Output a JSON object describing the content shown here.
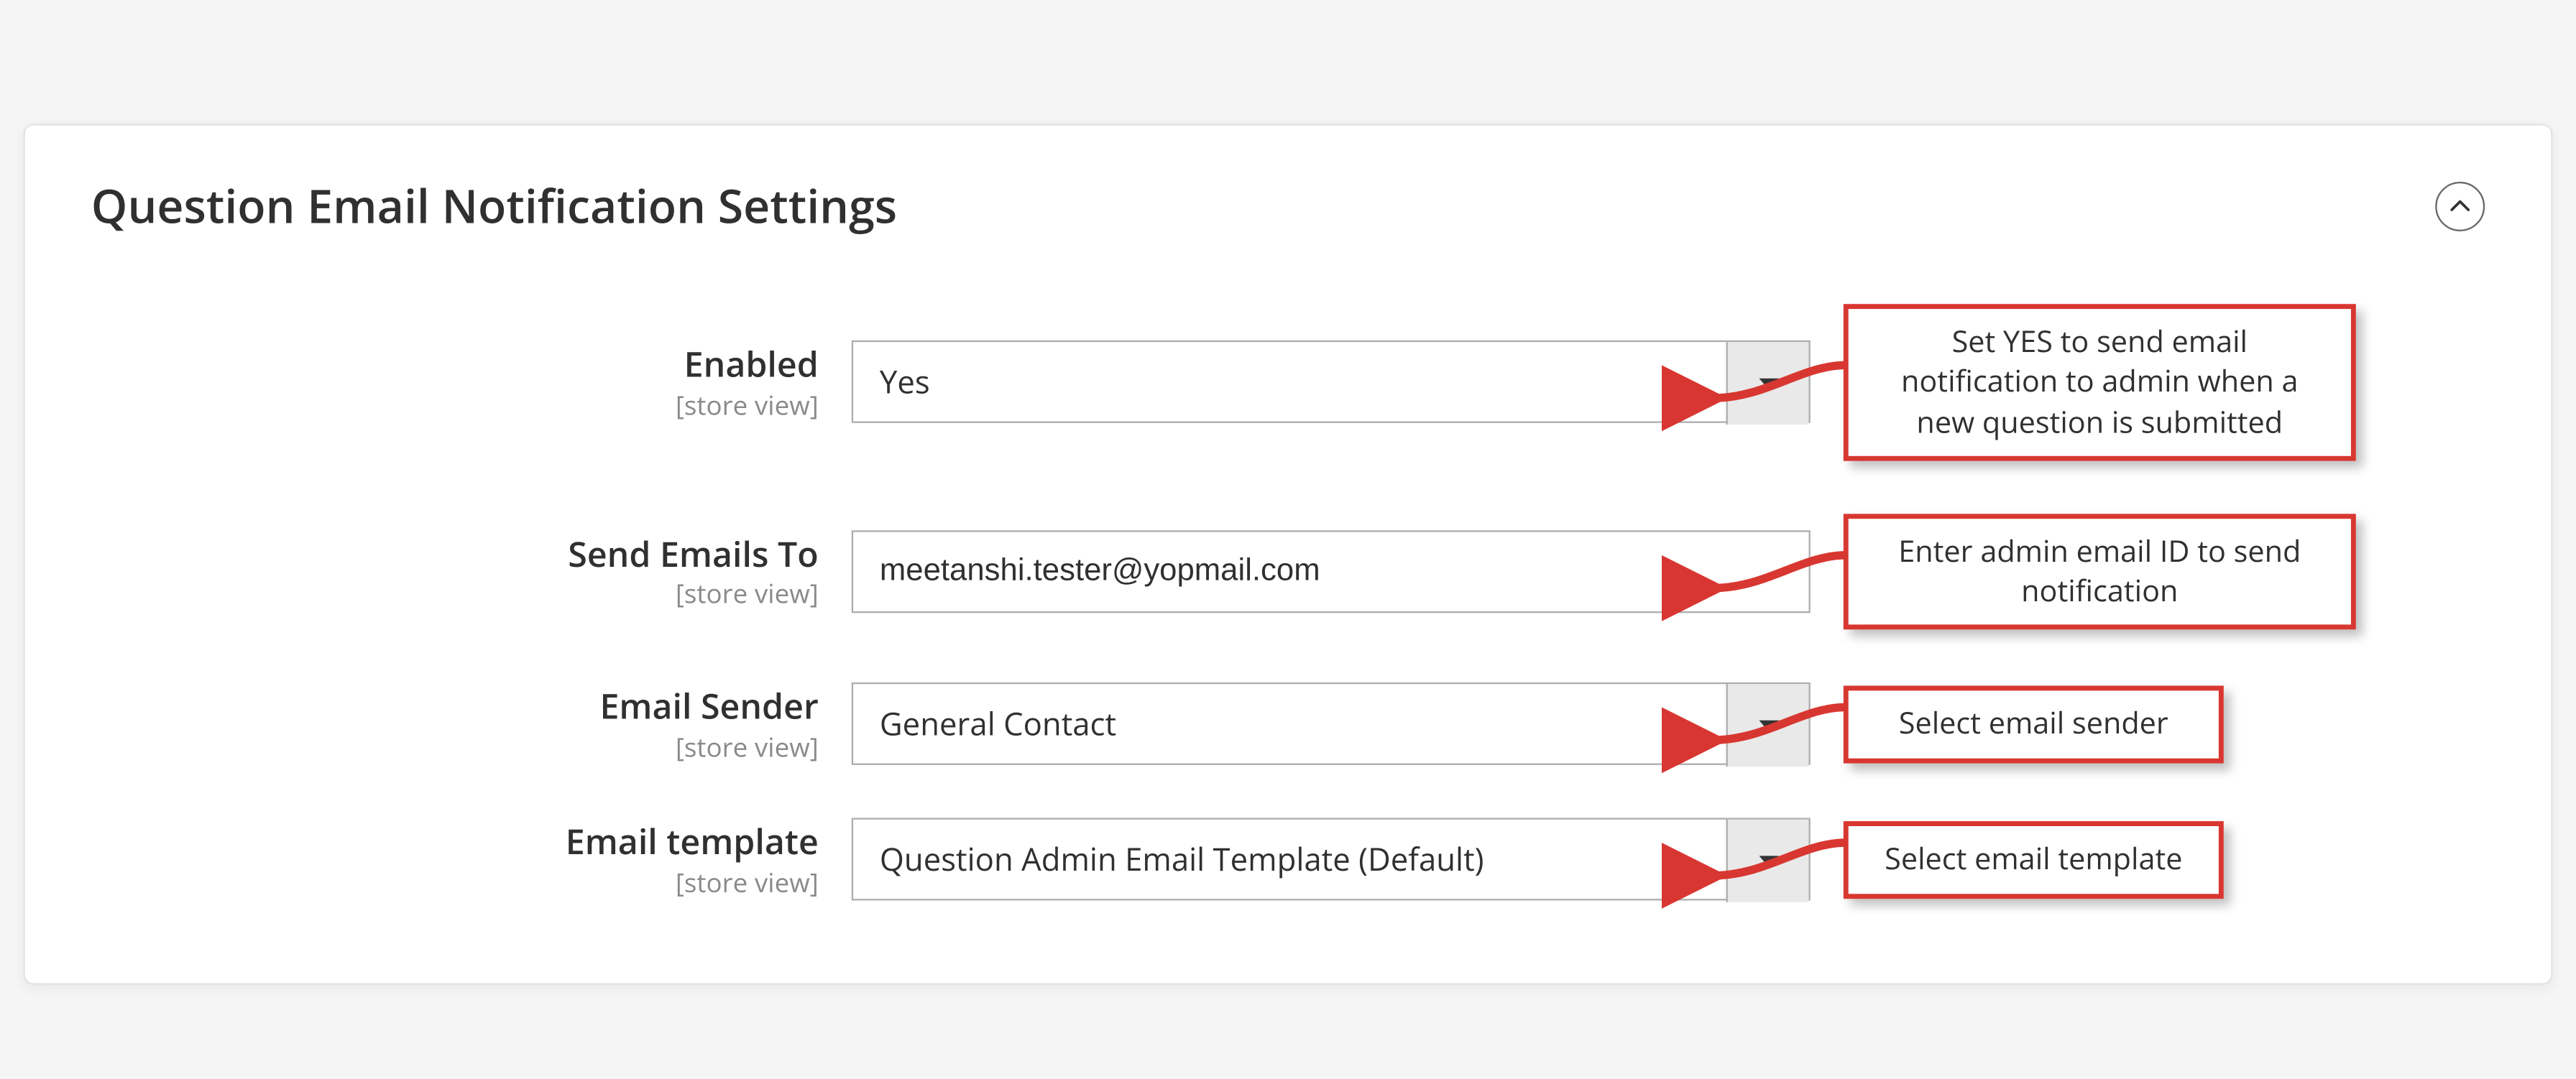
{
  "panel": {
    "title": "Question Email Notification Settings"
  },
  "scope_label": "[store view]",
  "fields": {
    "enabled": {
      "label": "Enabled",
      "value": "Yes",
      "callout": "Set YES to send email notification to admin when a new question is submitted"
    },
    "send_to": {
      "label": "Send Emails To",
      "value": "meetanshi.tester@yopmail.com",
      "callout": "Enter admin email ID to send notification"
    },
    "sender": {
      "label": "Email Sender",
      "value": "General Contact",
      "callout": "Select email sender"
    },
    "template": {
      "label": "Email template",
      "value": "Question Admin Email Template (Default)",
      "callout": "Select email template"
    }
  }
}
